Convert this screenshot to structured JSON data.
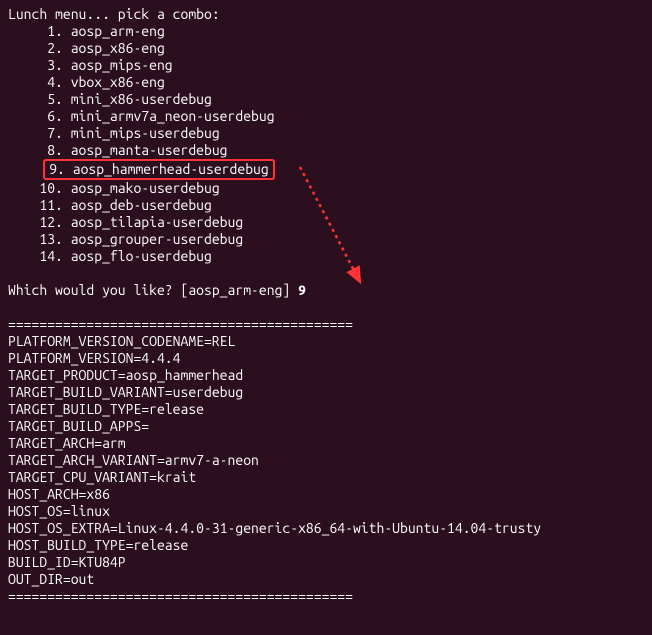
{
  "header": "Lunch menu... pick a combo:",
  "menu": {
    "items": [
      {
        "num": "1",
        "name": "aosp_arm-eng"
      },
      {
        "num": "2",
        "name": "aosp_x86-eng"
      },
      {
        "num": "3",
        "name": "aosp_mips-eng"
      },
      {
        "num": "4",
        "name": "vbox_x86-eng"
      },
      {
        "num": "5",
        "name": "mini_x86-userdebug"
      },
      {
        "num": "6",
        "name": "mini_armv7a_neon-userdebug"
      },
      {
        "num": "7",
        "name": "mini_mips-userdebug"
      },
      {
        "num": "8",
        "name": "aosp_manta-userdebug"
      },
      {
        "num": "9",
        "name": "aosp_hammerhead-userdebug"
      },
      {
        "num": "10",
        "name": "aosp_mako-userdebug"
      },
      {
        "num": "11",
        "name": "aosp_deb-userdebug"
      },
      {
        "num": "12",
        "name": "aosp_tilapia-userdebug"
      },
      {
        "num": "13",
        "name": "aosp_grouper-userdebug"
      },
      {
        "num": "14",
        "name": "aosp_flo-userdebug"
      }
    ]
  },
  "prompt": {
    "question": "Which would you like?",
    "default": "[aosp_arm-eng]",
    "input": "9"
  },
  "separator": "============================================",
  "env": {
    "lines": [
      "PLATFORM_VERSION_CODENAME=REL",
      "PLATFORM_VERSION=4.4.4",
      "TARGET_PRODUCT=aosp_hammerhead",
      "TARGET_BUILD_VARIANT=userdebug",
      "TARGET_BUILD_TYPE=release",
      "TARGET_BUILD_APPS=",
      "TARGET_ARCH=arm",
      "TARGET_ARCH_VARIANT=armv7-a-neon",
      "TARGET_CPU_VARIANT=krait",
      "HOST_ARCH=x86",
      "HOST_OS=linux",
      "HOST_OS_EXTRA=Linux-4.4.0-31-generic-x86_64-with-Ubuntu-14.04-trusty",
      "HOST_BUILD_TYPE=release",
      "BUILD_ID=KTU84P",
      "OUT_DIR=out"
    ]
  },
  "highlight_index": 8,
  "colors": {
    "bg": "#2c0f1e",
    "fg": "#ffffff",
    "highlight": "#ff3333"
  }
}
